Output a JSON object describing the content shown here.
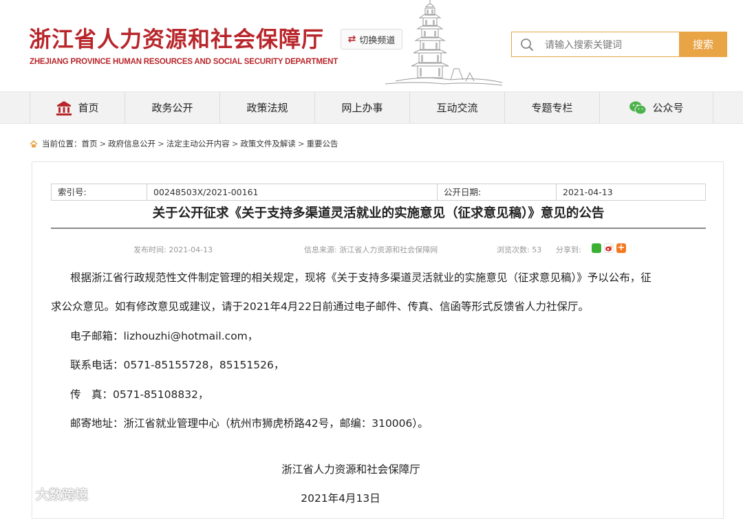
{
  "header": {
    "site_title": "浙江省人力资源和社会保障厅",
    "site_subtitle": "ZHEJIANG PROVINCE HUMAN RESOURCES AND SOCIAL SECURITY DEPARTMENT",
    "switch_channel_label": "切换频道",
    "search_placeholder": "请输入搜索关键词",
    "search_button": "搜索",
    "brand_color": "#b8262b",
    "accent_color": "#e9a446"
  },
  "nav": {
    "items": [
      {
        "label": "首页",
        "icon": "building-icon"
      },
      {
        "label": "政务公开"
      },
      {
        "label": "政策法规"
      },
      {
        "label": "网上办事"
      },
      {
        "label": "互动交流"
      },
      {
        "label": "专题专栏"
      },
      {
        "label": "公众号",
        "icon": "wechat-icon"
      }
    ]
  },
  "breadcrumb": {
    "prefix": "当前位置：",
    "items": [
      "首页",
      "政府信息公开",
      "法定主动公开内容",
      "政策文件及解读",
      "重要公告"
    ],
    "separator": ">"
  },
  "meta": {
    "index_label": "索引号:",
    "index_value": "00248503X/2021-00161",
    "date_label": "公开日期:",
    "date_value": "2021-04-13"
  },
  "article": {
    "title": "关于公开征求《关于支持多渠道灵活就业的实施意见（征求意见稿）》意见的公告",
    "published": "发布时间: 2021-04-13",
    "source": "信息来源: 浙江省人力资源和社会保障网",
    "views": "浏览次数: 53",
    "share_label": "分享到:",
    "para1_line1": "根据浙江省行政规范性文件制定管理的相关规定，现将《关于支持多渠道灵活就业的实施意见（征求意见稿）》予以公布，征",
    "para1_line2": "求公众意见。如有修改意见或建议，请于2021年4月22日前通过电子邮件、传真、信函等形式反馈省人力社保厅。",
    "email": "电子邮箱：lizhouzhi@hotmail.com，",
    "phone": "联系电话：0571-85155728，85151526，",
    "fax": "传　真：0571-85108832，",
    "address": "邮寄地址：浙江省就业管理中心（杭州市狮虎桥路42号，邮编：310006）。",
    "signature": "浙江省人力资源和社会保障厅",
    "sign_date": "2021年4月13日"
  },
  "watermark": {
    "text": "大数跨境"
  }
}
